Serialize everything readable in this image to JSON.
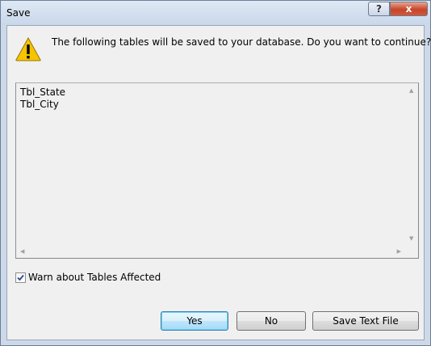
{
  "window": {
    "title": "Save",
    "help_label": "?",
    "close_label": "x"
  },
  "dialog": {
    "message": "The following tables will be saved to your database. Do you want to continue?",
    "tables": [
      "Tbl_State",
      "Tbl_City"
    ],
    "warn_checkbox": {
      "label": "Warn about Tables Affected",
      "checked": true
    },
    "buttons": {
      "yes": "Yes",
      "no": "No",
      "save_text_file": "Save Text File"
    }
  },
  "icons": {
    "warning": "warning-triangle-icon"
  },
  "colors": {
    "warning_fill": "#f5c400",
    "close_button": "#c7452a",
    "default_button_border": "#3c7fb1"
  }
}
